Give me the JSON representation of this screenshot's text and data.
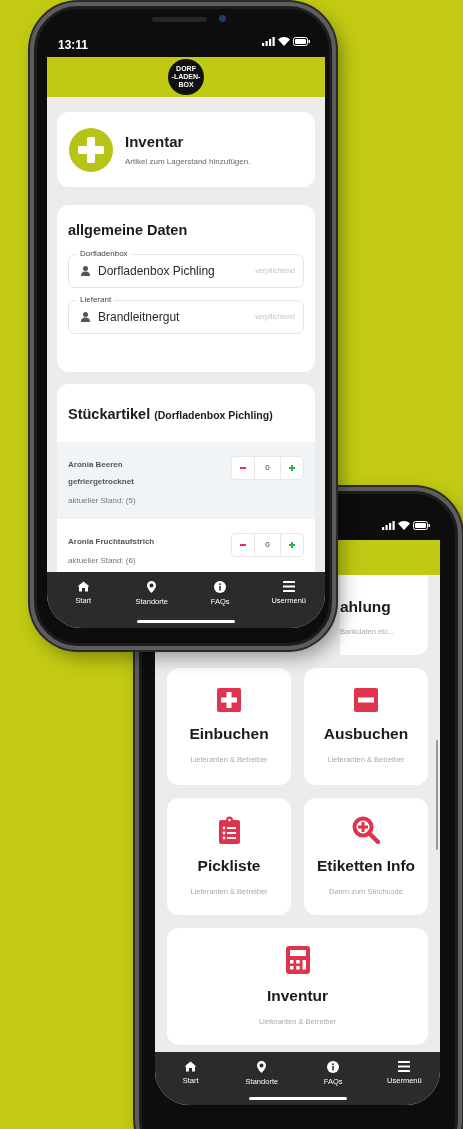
{
  "front_phone": {
    "time": "13:11",
    "logo": [
      "DORF",
      "-LADEN-",
      "BOX"
    ],
    "intro": {
      "title": "Inventar",
      "subtitle": "Artikel zum Lagerstand hinzufügen."
    },
    "general": {
      "title": "allgemeine Daten",
      "fields": [
        {
          "label": "Dorfladenbox",
          "value": "Dorfladenbox Pichling",
          "note": "verpflichtend"
        },
        {
          "label": "Lieferant",
          "value": "Brandleitnergut",
          "note": "verpflichtend"
        }
      ]
    },
    "items_section": {
      "title": "Stückartikel",
      "context": "(Dorfladenbox Pichling)"
    },
    "items": [
      {
        "name": "Aronia Beeren gefriergetrocknet",
        "stock": "aktueller Stand: (5)",
        "qty": "0",
        "selected": true
      },
      {
        "name": "Aronia Fruchtaufstrich",
        "stock": "aktueller Stand: (6)",
        "qty": "0",
        "selected": false
      }
    ],
    "nav": [
      {
        "kind": "home",
        "label": "Start"
      },
      {
        "kind": "pin",
        "label": "Standorte"
      },
      {
        "kind": "info",
        "label": "FAQs"
      },
      {
        "kind": "menu",
        "label": "Usermenü"
      }
    ]
  },
  "back_phone": {
    "partial_tile": {
      "title": "ahlung",
      "subtitle": "Bankdaten etc..."
    },
    "tiles": [
      {
        "kind": "plus",
        "title": "Einbuchen",
        "subtitle": "Lieferanten & Betreiber",
        "wide": false
      },
      {
        "kind": "minus",
        "title": "Ausbuchen",
        "subtitle": "Lieferanten & Betreiber",
        "wide": false
      },
      {
        "kind": "clipboard",
        "title": "Pickliste",
        "subtitle": "Lieferanten & Betreiber",
        "wide": false
      },
      {
        "kind": "zoom",
        "title": "Etiketten Info",
        "subtitle": "Daten zum Strichcode",
        "wide": false
      },
      {
        "kind": "calculator",
        "title": "Inventur",
        "subtitle": "Lieferanten & Betreiber",
        "wide": true
      }
    ],
    "nav": [
      {
        "kind": "home",
        "label": "Start"
      },
      {
        "kind": "pin",
        "label": "Standorte"
      },
      {
        "kind": "info",
        "label": "FAQs"
      },
      {
        "kind": "menu",
        "label": "Usermenü"
      }
    ]
  }
}
